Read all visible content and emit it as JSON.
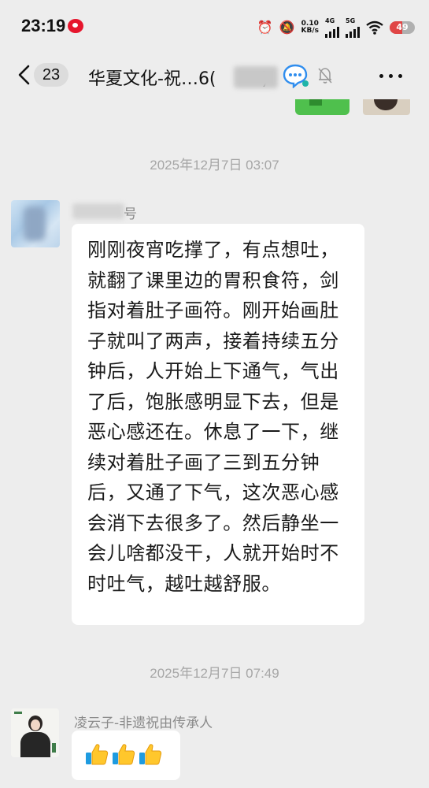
{
  "status_bar": {
    "time": "23:19",
    "net_speed_value": "0.10",
    "net_speed_unit": "KB/s",
    "signal1_label": "4G",
    "signal2_label": "5G",
    "battery": "49",
    "battery_color": "#e04545"
  },
  "nav": {
    "unread_count": "23",
    "title": "华夏文化-祝…6(",
    "title_suffix": ")"
  },
  "messages": [
    {
      "timestamp": "2025年12月7日 03:07",
      "sender_suffix": "号",
      "text": "刚刚夜宵吃撑了，有点想吐，就翻了课里边的胃积食符，剑指对着肚子画符。刚开始画肚子就叫了两声，接着持续五分钟后，人开始上下通气，气出了后，饱胀感明显下去，但是恶心感还在。休息了一下，继续对着肚子画了三到五分钟后，又通了下气，这次恶心感会消下去很多了。然后静坐一会儿啥都没干，人就开始时不时吐气，越吐越舒服。"
    },
    {
      "timestamp": "2025年12月7日 07:49",
      "sender": "凌云子-非遗祝由传承人",
      "emoji": [
        "thumbs-up",
        "thumbs-up",
        "thumbs-up"
      ]
    }
  ],
  "colors": {
    "background": "#ededed",
    "bubble": "#ffffff",
    "timestamp": "#a6a6a6",
    "qq_blue": "#2f8dee"
  }
}
